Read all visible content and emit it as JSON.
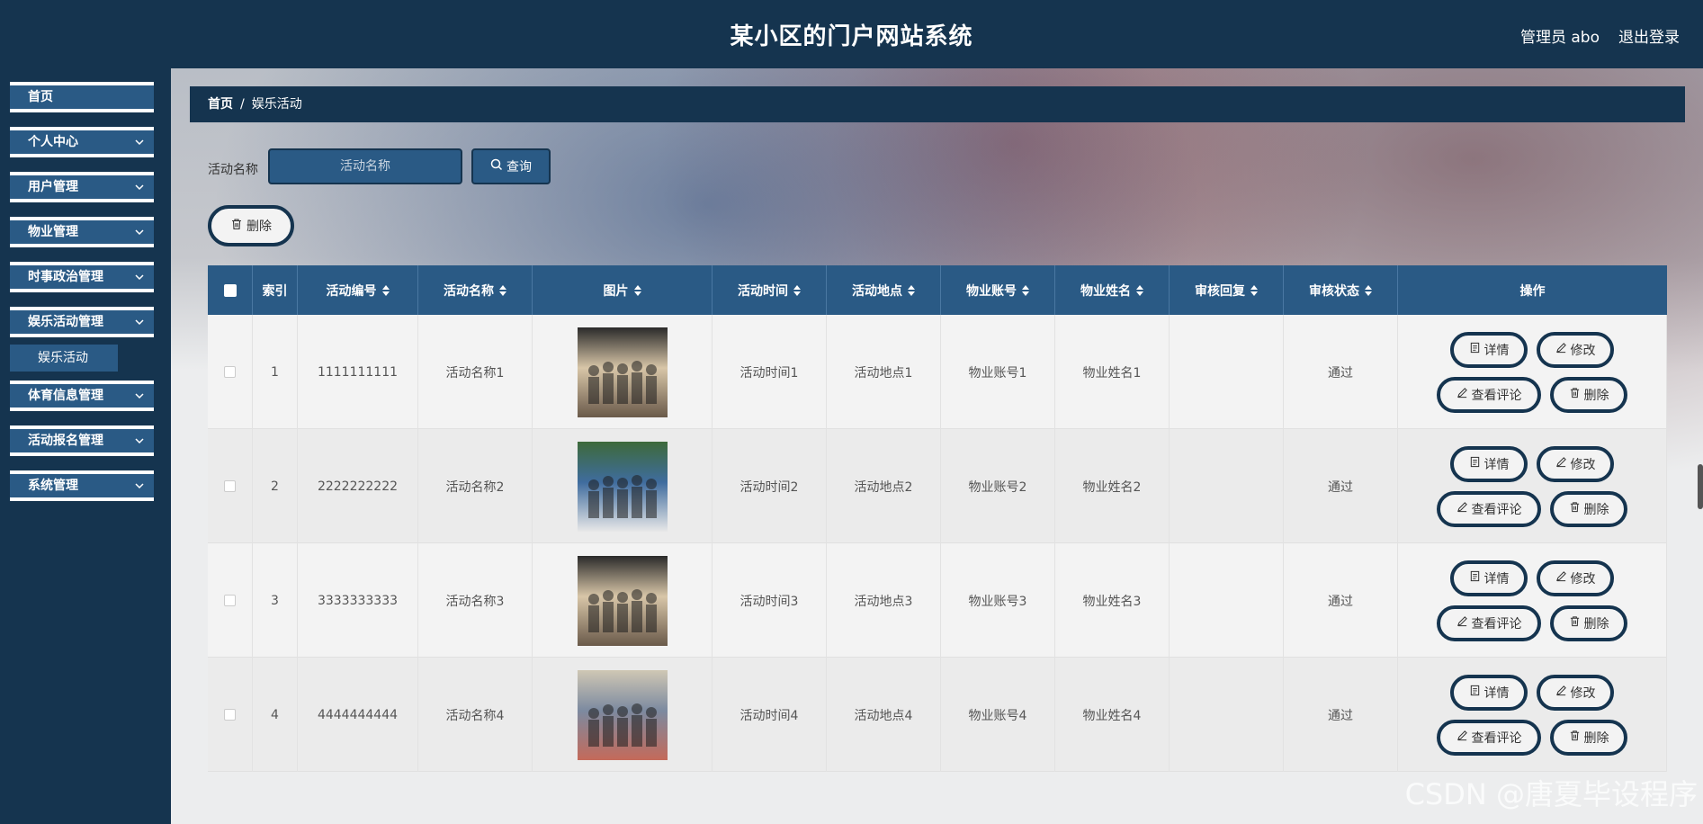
{
  "header": {
    "title": "某小区的门户网站系统",
    "user": "管理员 abo",
    "logout": "退出登录"
  },
  "sidebar": {
    "items": [
      {
        "label": "首页"
      },
      {
        "label": "个人中心"
      },
      {
        "label": "用户管理"
      },
      {
        "label": "物业管理"
      },
      {
        "label": "时事政治管理"
      },
      {
        "label": "娱乐活动管理"
      },
      {
        "label": "体育信息管理"
      },
      {
        "label": "活动报名管理"
      },
      {
        "label": "系统管理"
      }
    ],
    "sub_active": "娱乐活动"
  },
  "breadcrumb": {
    "home": "首页",
    "separator": "/",
    "current": "娱乐活动"
  },
  "search": {
    "label": "活动名称",
    "placeholder": "活动名称",
    "button": "查询"
  },
  "toolbar": {
    "delete_label": "删除"
  },
  "table": {
    "headers": [
      "索引",
      "活动编号",
      "活动名称",
      "图片",
      "活动时间",
      "活动地点",
      "物业账号",
      "物业姓名",
      "审核回复",
      "审核状态",
      "操作"
    ],
    "rows": [
      {
        "index": "1",
        "code": "1111111111",
        "name": "活动名称1",
        "time": "活动时间1",
        "place": "活动地点1",
        "account": "物业账号1",
        "owner": "物业姓名1",
        "reply": "",
        "status": "通过"
      },
      {
        "index": "2",
        "code": "2222222222",
        "name": "活动名称2",
        "time": "活动时间2",
        "place": "活动地点2",
        "account": "物业账号2",
        "owner": "物业姓名2",
        "reply": "",
        "status": "通过"
      },
      {
        "index": "3",
        "code": "3333333333",
        "name": "活动名称3",
        "time": "活动时间3",
        "place": "活动地点3",
        "account": "物业账号3",
        "owner": "物业姓名3",
        "reply": "",
        "status": "通过"
      },
      {
        "index": "4",
        "code": "4444444444",
        "name": "活动名称4",
        "time": "活动时间4",
        "place": "活动地点4",
        "account": "物业账号4",
        "owner": "物业姓名4",
        "reply": "",
        "status": "通过"
      }
    ],
    "actions": {
      "detail": "详情",
      "edit": "修改",
      "comments": "查看评论",
      "delete": "删除"
    }
  },
  "watermark": "CSDN @唐夏毕设程序",
  "colors": {
    "header": "#15344f",
    "accent": "#2a5a85"
  }
}
